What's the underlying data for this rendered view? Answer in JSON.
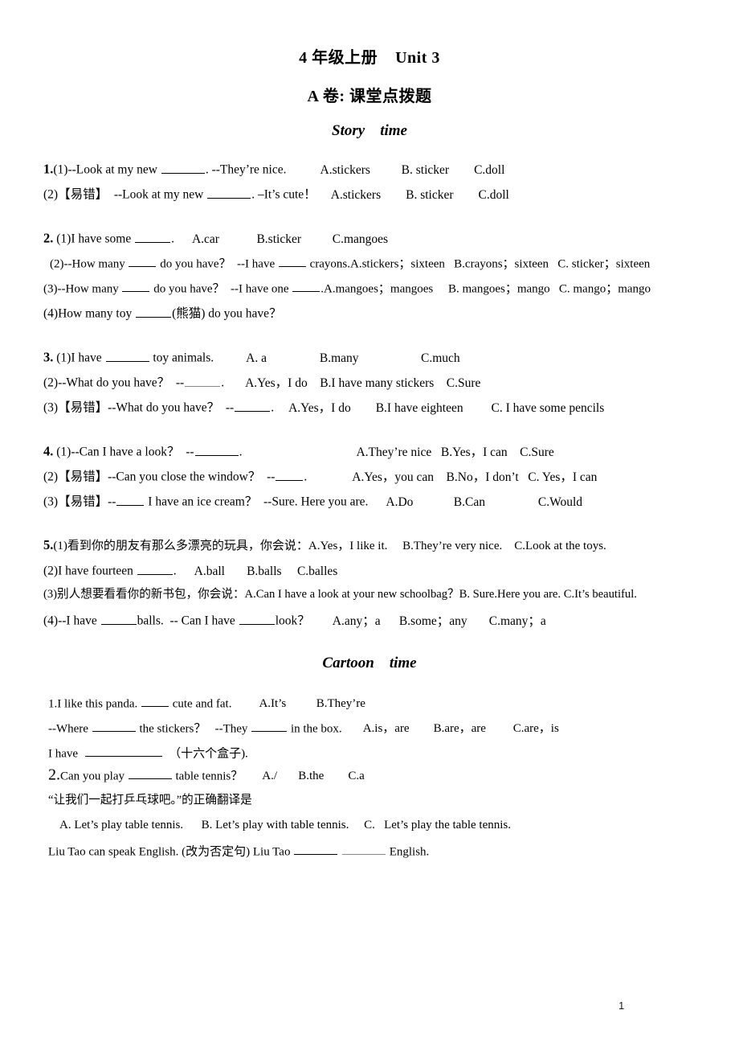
{
  "document": {
    "title_line1": "4 年级上册    Unit 3",
    "title_line2": "A 卷: 课堂点拨题",
    "page_number": "1"
  },
  "sections": [
    {
      "id": "story",
      "heading": "Story    time"
    },
    {
      "id": "cartoon",
      "heading": "Cartoon    time"
    }
  ],
  "story": {
    "q1": {
      "number": "1.",
      "items": [
        {
          "label": "(1)",
          "stem_a": "--Look at my new ",
          "stem_b": ". --They’re nice.",
          "options": "A.stickers          B. sticker        C.doll"
        },
        {
          "label": "(2)【易错】",
          "stem_a": "  --Look at my new ",
          "stem_b": ". –It’s cute！",
          "options": "A.stickers        B. sticker        C.doll"
        }
      ]
    },
    "q2": {
      "number": "2.",
      "items": [
        {
          "label": "(1)",
          "stem_a": "I have some ",
          "stem_b": ".",
          "options": "A.car            B.sticker          C.mangoes"
        },
        {
          "label": "(2)",
          "stem_a": "--How many ",
          "stem_mid": " do you have？  --I have ",
          "stem_b": " crayons.",
          "options": "A.stickers；sixteen   B.crayons；sixteen   C. sticker；sixteen"
        },
        {
          "label": "(3)",
          "stem_a": "--How many ",
          "stem_mid": " do you have？  --I have one ",
          "stem_b": ".",
          "options": "A.mangoes；mangoes     B. mangoes；mango   C. mango；mango"
        },
        {
          "label": "(4)",
          "stem_a": "How many toy ",
          "stem_b": "(熊猫) do you have？",
          "options": ""
        }
      ]
    },
    "q3": {
      "number": "3.",
      "items": [
        {
          "label": "(1)",
          "stem_a": "I have ",
          "stem_b": " toy animals.",
          "options": "A. a                 B.many                    C.much"
        },
        {
          "label": "(2)",
          "stem_a": "--What do you have？  --",
          "stem_b": ".",
          "options": "A.Yes，I do    B.I have many stickers    C.Sure"
        },
        {
          "label": "(3)【易错】",
          "stem_a": "--What do you have？  --",
          "stem_b": ".",
          "options": "A.Yes，I do        B.I have eighteen         C. I have some pencils"
        }
      ]
    },
    "q4": {
      "number": "4.",
      "items": [
        {
          "label": "(1)",
          "stem_a": "--Can I have a look？  --",
          "stem_b": ".",
          "options": "A.They’re nice   B.Yes，I can    C.Sure"
        },
        {
          "label": "(2)【易错】",
          "stem_a": "--Can you close the window？  --",
          "stem_b": ".",
          "options": "A.Yes，you can    B.No，I don’t   C. Yes，I can"
        },
        {
          "label": "(3)【易错】",
          "stem_a": "--",
          "stem_b": " I have an ice cream？  --Sure. Here you are.",
          "options": "A.Do             B.Can                 C.Would"
        }
      ]
    },
    "q5": {
      "number": "5.",
      "items": [
        {
          "label": "(1)",
          "stem_a": "看到你的朋友有那么多漂亮的玩具，你会说：",
          "stem_b": "",
          "options": "A.Yes，I like it.     B.They’re very nice.    C.Look at the toys."
        },
        {
          "label": "(2)",
          "stem_a": "I have fourteen ",
          "stem_b": ".",
          "options": "A.ball       B.balls     C.balles"
        },
        {
          "label": "(3)",
          "stem_a": "别人想要看看你的新书包，你会说：",
          "stem_b": "",
          "options": "A.Can I have a look at your new schoolbag？B. Sure.Here you are. C.It’s beautiful."
        },
        {
          "label": "(4)",
          "stem_a": "--I have ",
          "stem_mid": "balls.  -- Can I have ",
          "stem_b": "look？",
          "options": "A.any；a      B.some；any       C.many；a"
        }
      ]
    }
  },
  "cartoon": {
    "item1": {
      "number": "1.",
      "line1_a": "I like this panda. ",
      "line1_b": " cute and fat.",
      "line1_options": "A.It’s          B.They’re",
      "line2_a": "--Where ",
      "line2_mid": " the stickers？   --They ",
      "line2_b": " in the box.",
      "line2_options": "A.is，are        B.are，are         C.are，is",
      "line3_a": "I have  ",
      "line3_b": "  （十六个盒子)."
    },
    "item2": {
      "number": "2.",
      "line1_a": "Can you play ",
      "line1_b": " table tennis？",
      "line1_options": "A./       B.the        C.a",
      "line2": "“让我们一起打乒乓球吧。”的正确翻译是",
      "choices": "A. Let’s play table tennis.      B. Let’s play with table tennis.     C.   Let’s play the table tennis.",
      "line4_a": "Liu Tao can speak English. (改为否定句) Liu Tao ",
      "line4_mid": " ",
      "line4_b": " English."
    }
  }
}
